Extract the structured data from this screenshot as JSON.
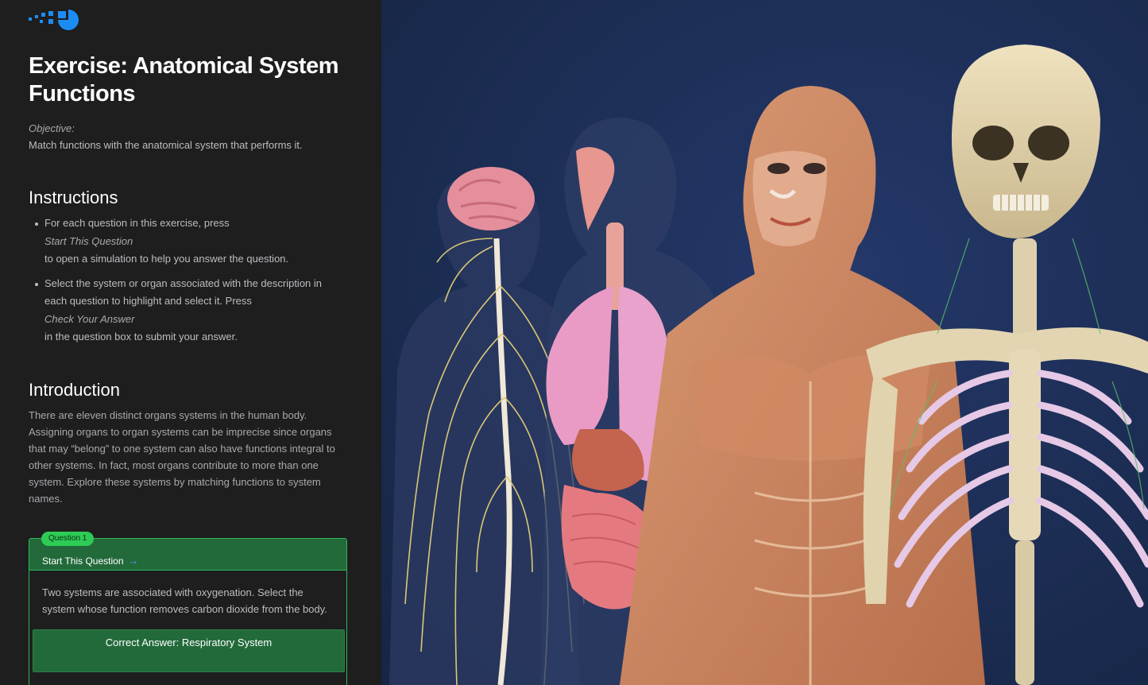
{
  "exercise": {
    "title": "Exercise: Anatomical System Functions",
    "objective_label": "Objective:",
    "objective_text": "Match functions with the anatomical system that performs it."
  },
  "instructions": {
    "heading": "Instructions",
    "items": [
      {
        "before": "For each question in this exercise, press",
        "emphasis": "Start This Question",
        "after": "to open a simulation to help you answer the question."
      },
      {
        "before1": "Select the system or organ associated with the description in",
        "before2": "each question to highlight and select it. Press",
        "emphasis": "Check Your Answer",
        "after": "in the question box to submit your answer."
      }
    ]
  },
  "introduction": {
    "heading": "Introduction",
    "text": "There are eleven distinct organs systems in the human body. Assigning organs to organ systems can be imprecise since organs that may “belong” to one system can also have functions integral to other systems. In fact, most organs contribute to more than one system. Explore these systems by matching functions to system names."
  },
  "question": {
    "badge": "Question 1",
    "start_label": "Start This Question",
    "arrow": "→",
    "text": "Two systems are associated with oxygenation. Select the system whose function removes carbon dioxide from the body.",
    "answer": "Correct Answer: Respiratory System"
  },
  "colors": {
    "accent_blue": "#1c8cf5",
    "green": "#2ecc55",
    "card_green": "#236a3b",
    "hero_bg": "#1b2a4e"
  },
  "icons": {
    "logo": "visible-body-logo-icon",
    "arrow": "arrow-right-icon"
  }
}
